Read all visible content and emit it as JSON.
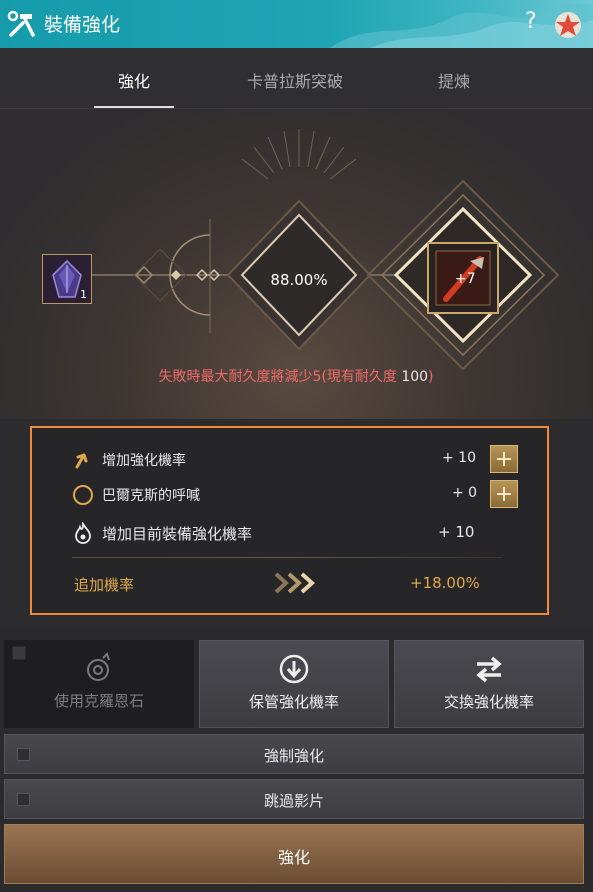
{
  "header": {
    "title": "裝備強化",
    "help": "?",
    "title_icon": "hammer-wrench-icon",
    "corner_icon": "star-icon"
  },
  "tabs": [
    {
      "label": "強化",
      "active": true
    },
    {
      "label": "卡普拉斯突破",
      "active": false
    },
    {
      "label": "提煉",
      "active": false
    }
  ],
  "enhance": {
    "material_count": "1",
    "success_rate": "88.00%",
    "item_level": "+7",
    "warning_prefix": "失敗時最大耐久度將減少5(現有耐久度 ",
    "warning_durability": "100",
    "warning_suffix": ")"
  },
  "bonus": {
    "rows": [
      {
        "label": "增加強化機率",
        "value": "+ 10",
        "icon": "arrow-up-icon"
      },
      {
        "label": "巴爾克斯的呼喊",
        "value": "+ 0",
        "icon": "moon-orb-icon"
      },
      {
        "label": "增加目前裝備強化機率",
        "value": "+ 10",
        "icon": "flame-icon"
      }
    ],
    "total_label": "追加機率",
    "total_value": "+18.00%"
  },
  "options": {
    "cron_stone": "使用克羅恩石",
    "keep_rate": "保管強化機率",
    "swap_rate": "交換強化機率"
  },
  "toggles": {
    "force": "強制強化",
    "skip": "跳過影片"
  },
  "enhance_button": "強化",
  "colors": {
    "accent": "#f08a3a",
    "gold": "#e0a94a",
    "warning": "#f06a6a",
    "header": "#1ea4b3"
  }
}
